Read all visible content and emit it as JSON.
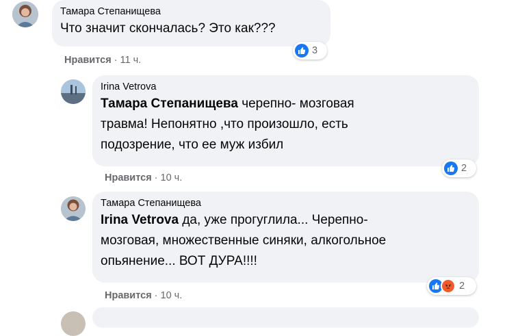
{
  "comments": [
    {
      "author": "Тамара Степанищева",
      "tag": "",
      "text": "Что значит скончалась? Это как???",
      "like_label": "Нравится",
      "time": "11 ч.",
      "reaction_count": "3"
    },
    {
      "author": "Irina Vetrova",
      "tag": "Тамара Степанищева",
      "text_lines": [
        "черепно- мозговая",
        "травма! Непонятно ,что произошло, есть",
        "подозрение, что ее муж избил"
      ],
      "like_label": "Нравится",
      "time": "10 ч.",
      "reaction_count": "2"
    },
    {
      "author": "Тамара Степанищева",
      "tag": "Irina Vetrova",
      "text_lines": [
        "да, уже прогуглила... Черепно-",
        "мозговая, множественные синяки, алкогольное",
        "опьянение... ВОТ ДУРА!!!!"
      ],
      "like_label": "Нравится",
      "time": "10 ч.",
      "reaction_count": "2"
    }
  ],
  "colors": {
    "bubble": "#f0f2f5",
    "meta_text": "#65676b",
    "like_blue": "#1877f2",
    "angry_orange": "#f35a2a"
  },
  "icons": [
    "like-reaction-icon",
    "angry-reaction-icon"
  ]
}
